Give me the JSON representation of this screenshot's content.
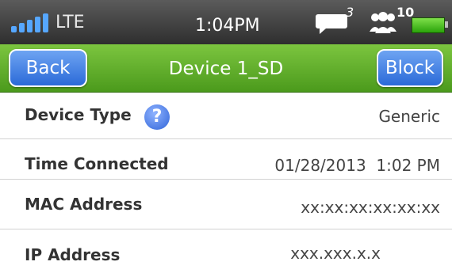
{
  "status_bar": {
    "network": "LTE",
    "time": "1:04PM",
    "message_count": "3",
    "users_count": "10"
  },
  "nav": {
    "back_label": "Back",
    "title": "Device 1_SD",
    "block_label": "Block"
  },
  "rows": [
    {
      "label": "Device Type",
      "value": "Generic"
    },
    {
      "label": "Time Connected",
      "value": "01/28/2013  1:02 PM"
    },
    {
      "label": "MAC Address",
      "value": "xx:xx:xx:xx:xx:xx"
    },
    {
      "label": "IP Address",
      "value": "xxx.xxx.x.x"
    }
  ],
  "colors": {
    "nav_green": "#5fae2a",
    "button_blue": "#3b78e0",
    "battery_green": "#3fbe18"
  }
}
